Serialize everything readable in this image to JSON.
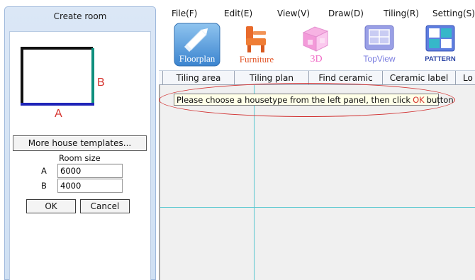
{
  "left_panel": {
    "title": "Create room",
    "preview": {
      "label_a": "A",
      "label_b": "B"
    },
    "more_templates": "More house templates...",
    "room_size_label": "Room size",
    "a_label": "A",
    "a_value": "6000",
    "b_label": "B",
    "b_value": "4000",
    "ok": "OK",
    "cancel": "Cancel"
  },
  "menu": {
    "file": "File(F)",
    "edit": "Edit(E)",
    "view": "View(V)",
    "draw": "Draw(D)",
    "tiling": "Tiling(R)",
    "setting": "Setting(S)"
  },
  "toolbar": {
    "floorplan": "Floorplan",
    "furniture": "Furniture",
    "threed": "3D",
    "topview": "TopView",
    "pattern": "PATTERN"
  },
  "tabs": [
    "Tiling area",
    "Tiling plan",
    "Find ceramic",
    "Ceramic label",
    "Lo"
  ],
  "hint": {
    "before": "Please choose a housetype from the left panel, then click",
    "ok": "OK",
    "after": "button"
  },
  "colors": {
    "hint_ok": "#d6322d",
    "annotation_ellipse": "#d12f2f",
    "guide_lines": "#59c8d0",
    "preview_top_left": "#111111",
    "preview_bottom": "#1f24b8",
    "preview_right": "#0f8f7d",
    "preview_labels": "#d6322d"
  }
}
